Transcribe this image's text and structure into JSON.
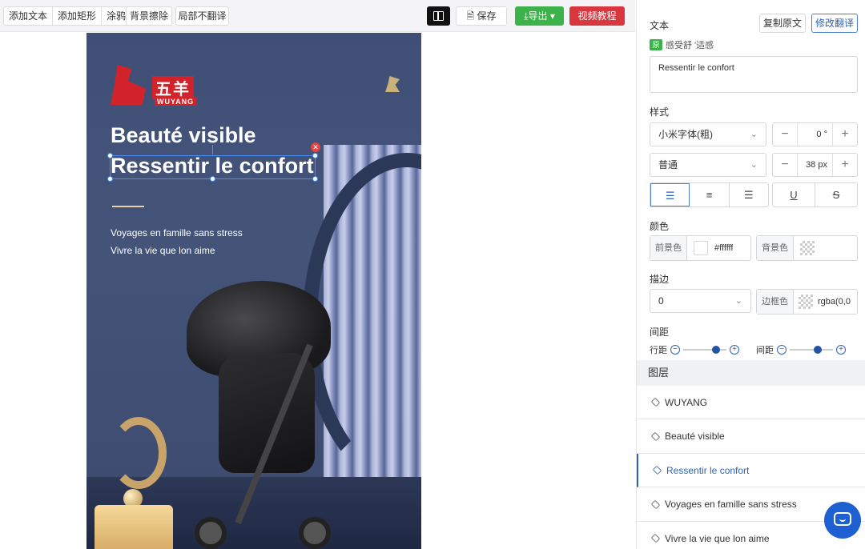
{
  "toolbar": {
    "add_text": "添加文本",
    "add_rect": "添加矩形",
    "doodle": "涂鸦",
    "bg_erase": "背景擦除",
    "partial_no_translate": "局部不翻译",
    "save": "保存",
    "export": "导出",
    "video_tutorial": "视频教程"
  },
  "poster": {
    "brand_cn": "五羊",
    "brand_en": "WUYANG",
    "headline1": "Beauté visible",
    "headline2": "Ressentir le confort",
    "line1": "Voyages en famille sans stress",
    "line2": "Vivre la vie que lon aime"
  },
  "panel": {
    "text_label": "文本",
    "copy_original": "复制原文",
    "edit_translation": "修改翻译",
    "original_tag": "原",
    "original_text": "感受舒 '适感",
    "translation_value": "Ressentir le confort",
    "style_label": "样式",
    "font_family": "小米字体(粗)",
    "letter_spacing": "0",
    "font_weight": "普通",
    "font_size": "38",
    "font_unit": "px",
    "color_label": "颜色",
    "fg_label": "前景色",
    "fg_value": "#ffffff",
    "bg_label": "背景色",
    "stroke_label": "描边",
    "stroke_width": "0",
    "border_color_label": "边框色",
    "border_color_value": "rgba(0,0",
    "spacing_label": "间距",
    "line_spacing_label": "行距",
    "char_spacing_label": "间距",
    "line_spacing_level": 0.75,
    "char_spacing_level": 0.65
  },
  "layers": {
    "title": "图层",
    "items": [
      "WUYANG",
      "Beauté visible",
      "Ressentir le confort",
      "Voyages en famille sans stress",
      "Vivre la vie que lon aime"
    ],
    "active_index": 2
  },
  "colors": {
    "accent": "#2f62b5",
    "export_green": "#3cb34a",
    "video_red": "#d9363e",
    "poster_bg": "#445479"
  }
}
